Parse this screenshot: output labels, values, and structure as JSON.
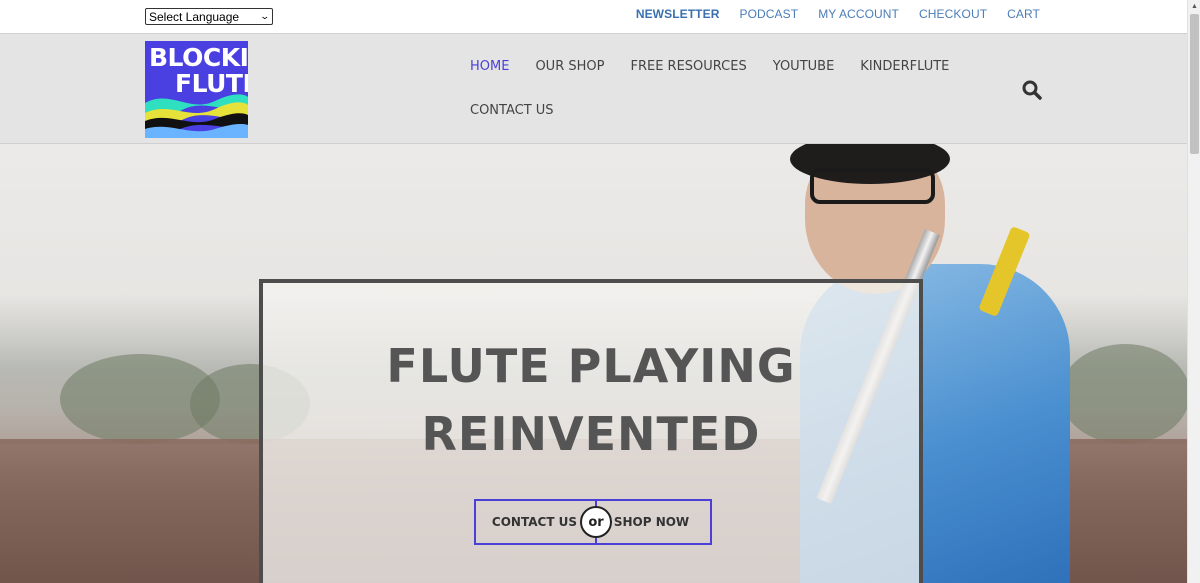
{
  "topbar": {
    "language_select": "Select Language",
    "links": [
      "NEWSLETTER",
      "PODCAST",
      "MY ACCOUNT",
      "CHECKOUT",
      "CART"
    ]
  },
  "logo": {
    "line1": "BLOCKI",
    "line2": "FLUTE"
  },
  "nav": {
    "items": [
      "HOME",
      "OUR SHOP",
      "FREE RESOURCES",
      "YOUTUBE",
      "KINDERFLUTE",
      "CONTACT US"
    ],
    "active": "HOME"
  },
  "hero": {
    "title_line1": "FLUTE PLAYING",
    "title_line2": "REINVENTED",
    "cta_left": "CONTACT US",
    "cta_or": "or",
    "cta_right": "SHOP NOW"
  },
  "colors": {
    "accent": "#4b3fd6",
    "link": "#4a7db8",
    "header_bg": "#e4e4e4"
  }
}
